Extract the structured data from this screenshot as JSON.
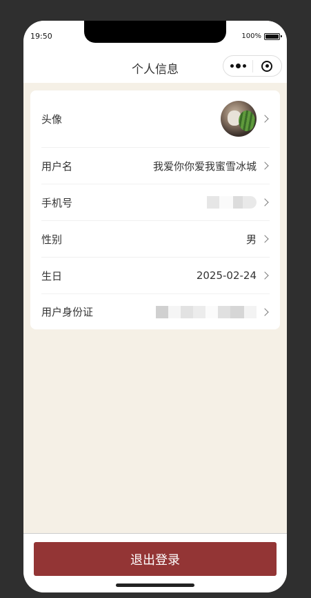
{
  "status_bar": {
    "time": "19:50",
    "battery": "100%"
  },
  "navbar": {
    "title": "个人信息"
  },
  "profile": {
    "avatar_label": "头像",
    "username_label": "用户名",
    "username_value": "我爱你你爱我蜜雪冰城",
    "phone_label": "手机号",
    "gender_label": "性别",
    "gender_value": "男",
    "birthday_label": "生日",
    "birthday_value": "2025-02-24",
    "idcard_label": "用户身份证"
  },
  "footer": {
    "logout_label": "退出登录"
  },
  "colors": {
    "accent": "#933535",
    "page_bg": "#f5f0e6"
  }
}
